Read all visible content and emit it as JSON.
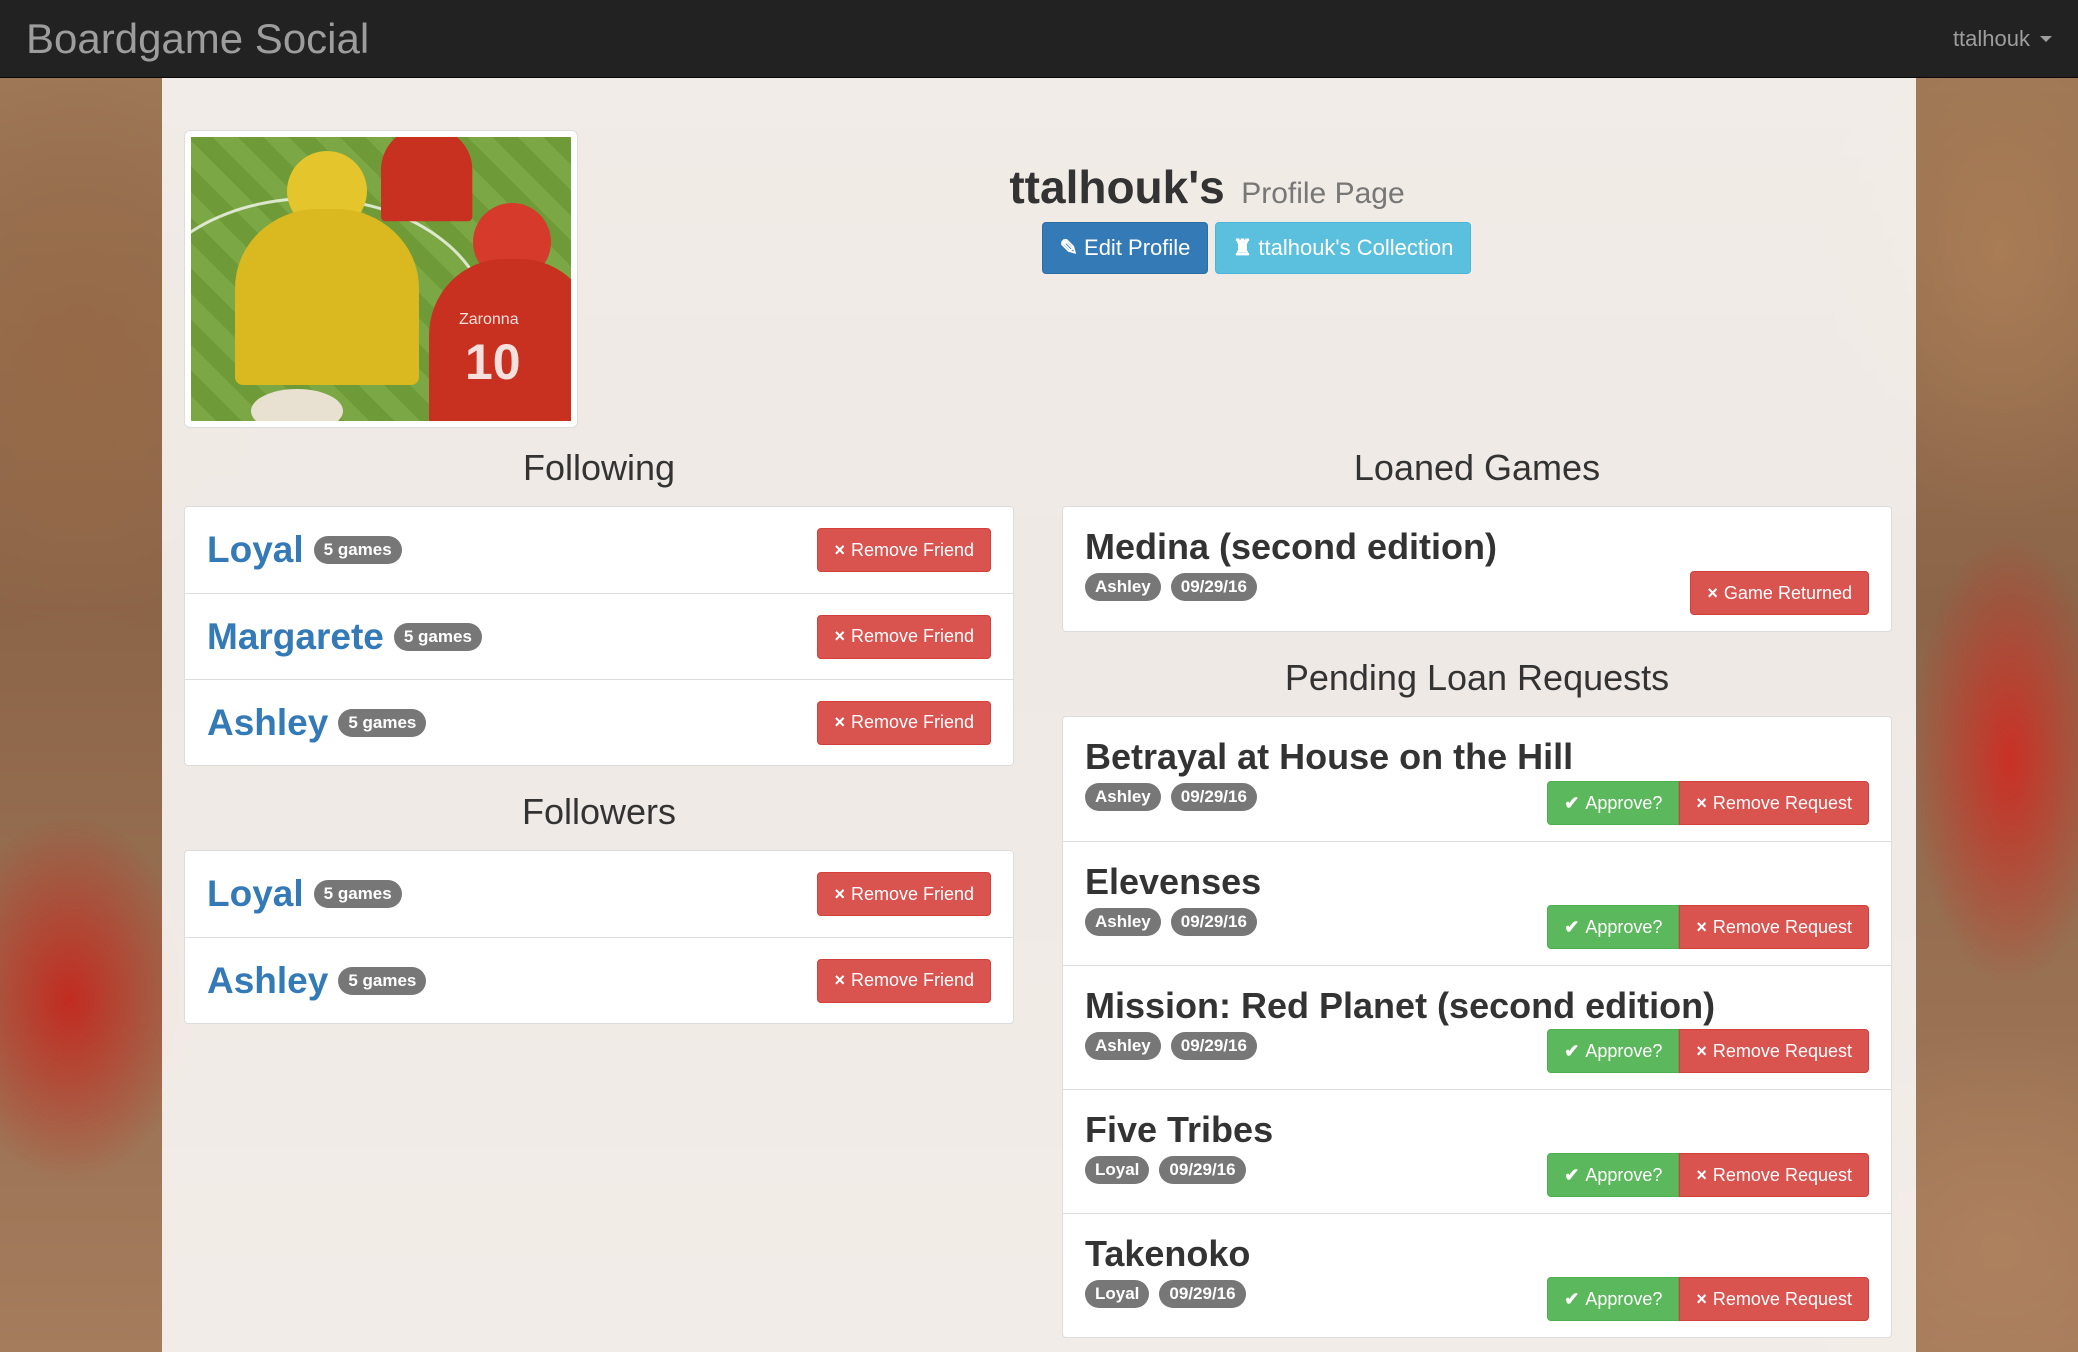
{
  "nav": {
    "brand": "Boardgame Social",
    "user": "ttalhouk"
  },
  "profile": {
    "username_title": "ttalhouk's",
    "subtitle": "Profile Page",
    "edit_label": "Edit Profile",
    "collection_label": "ttalhouk's Collection"
  },
  "avatar": {
    "jersey_name": "Zaronna",
    "jersey_number": "10"
  },
  "following": {
    "heading": "Following",
    "items": [
      {
        "name": "Loyal",
        "badge": "5 games",
        "action": "Remove Friend"
      },
      {
        "name": "Margarete",
        "badge": "5 games",
        "action": "Remove Friend"
      },
      {
        "name": "Ashley",
        "badge": "5 games",
        "action": "Remove Friend"
      }
    ]
  },
  "followers": {
    "heading": "Followers",
    "items": [
      {
        "name": "Loyal",
        "badge": "5 games",
        "action": "Remove Friend"
      },
      {
        "name": "Ashley",
        "badge": "5 games",
        "action": "Remove Friend"
      }
    ]
  },
  "loaned": {
    "heading": "Loaned Games",
    "items": [
      {
        "title": "Medina (second edition)",
        "user": "Ashley",
        "date": "09/29/16",
        "action": "Game Returned"
      }
    ]
  },
  "pending": {
    "heading": "Pending Loan Requests",
    "approve_label": "Approve?",
    "remove_label": "Remove Request",
    "items": [
      {
        "title": "Betrayal at House on the Hill",
        "user": "Ashley",
        "date": "09/29/16"
      },
      {
        "title": "Elevenses",
        "user": "Ashley",
        "date": "09/29/16"
      },
      {
        "title": "Mission: Red Planet (second edition)",
        "user": "Ashley",
        "date": "09/29/16"
      },
      {
        "title": "Five Tribes",
        "user": "Loyal",
        "date": "09/29/16"
      },
      {
        "title": "Takenoko",
        "user": "Loyal",
        "date": "09/29/16"
      }
    ]
  },
  "icons": {
    "remove": "×",
    "approve": "✔",
    "edit": "✎",
    "collection": "♜"
  },
  "colors": {
    "primary": "#337ab7",
    "info": "#5bc0de",
    "danger": "#d9534f",
    "success": "#5cb85c",
    "badge": "#777777",
    "navbar": "#222222"
  }
}
